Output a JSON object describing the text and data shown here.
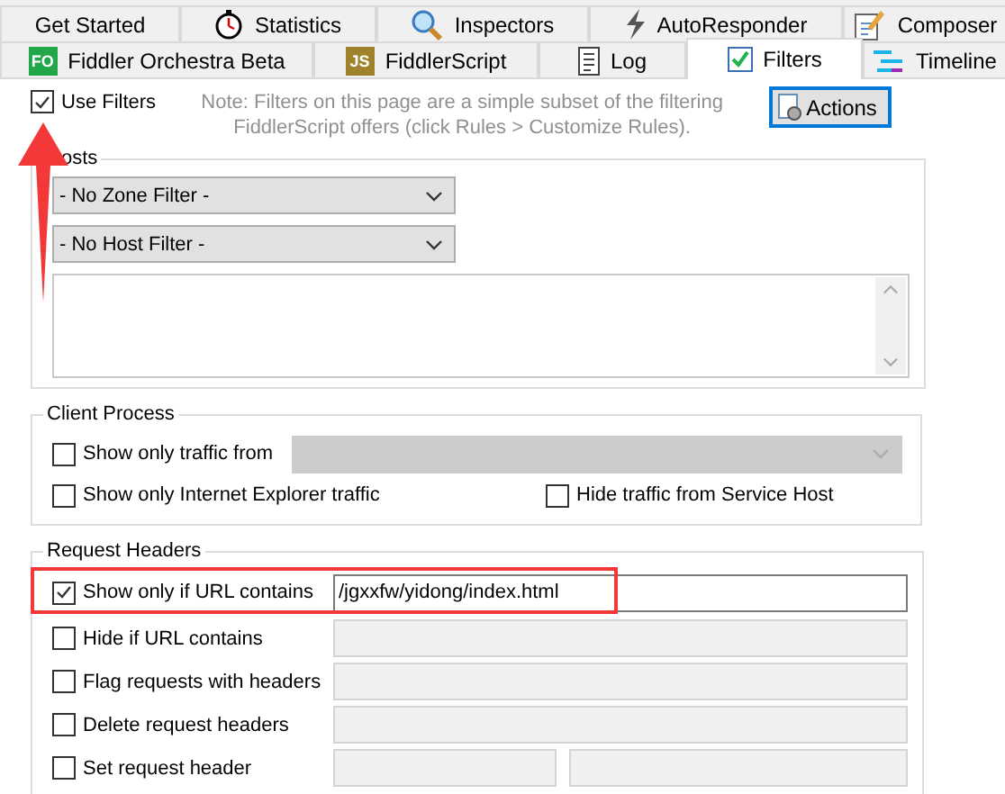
{
  "tabs": {
    "row_1": [
      {
        "label": "Get Started",
        "selected": false
      },
      {
        "label": "Statistics",
        "selected": false
      },
      {
        "label": "Inspectors",
        "selected": false
      },
      {
        "label": "AutoResponder",
        "selected": false
      },
      {
        "label": "Composer",
        "selected": false
      }
    ],
    "row_2": [
      {
        "label": "Fiddler Orchestra Beta",
        "badge": "FO",
        "selected": false
      },
      {
        "label": "FiddlerScript",
        "badge": "JS",
        "selected": false
      },
      {
        "label": "Log",
        "selected": false
      },
      {
        "label": "Filters",
        "selected": true
      },
      {
        "label": "Timeline",
        "selected": false
      }
    ]
  },
  "use_filters": {
    "label": "Use Filters",
    "checked": true
  },
  "note": "Note: Filters on this page are a simple subset of the filtering FiddlerScript offers (click Rules > Customize Rules).",
  "actions_button": {
    "label": "Actions"
  },
  "hosts": {
    "title": "osts",
    "zone_filter": "- No Zone Filter -",
    "host_filter": "- No Host Filter -"
  },
  "client_process": {
    "title": "Client Process",
    "options": [
      {
        "label": "Show only traffic from",
        "checked": false
      },
      {
        "label": "Show only Internet Explorer traffic",
        "checked": false
      },
      {
        "label": "Hide traffic from Service Host",
        "checked": false
      }
    ],
    "process_select": {
      "disabled": true
    }
  },
  "request_headers": {
    "title": "Request Headers",
    "rows": [
      {
        "label": "Show only if URL contains",
        "checked": true,
        "highlighted": true,
        "fields": [
          {
            "value": "/jgxxfw/yidong/index.html",
            "disabled": false
          }
        ]
      },
      {
        "label": "Hide if URL contains",
        "checked": false,
        "highlighted": false,
        "fields": [
          {
            "disabled": true
          }
        ]
      },
      {
        "label": "Flag requests with headers",
        "checked": false,
        "highlighted": false,
        "fields": [
          {
            "disabled": true
          }
        ]
      },
      {
        "label": "Delete request headers",
        "checked": false,
        "highlighted": false,
        "fields": [
          {
            "disabled": true
          }
        ]
      },
      {
        "label": "Set request header",
        "checked": false,
        "highlighted": false,
        "fields": [
          {
            "disabled": true
          },
          {
            "disabled": true
          }
        ]
      }
    ]
  }
}
